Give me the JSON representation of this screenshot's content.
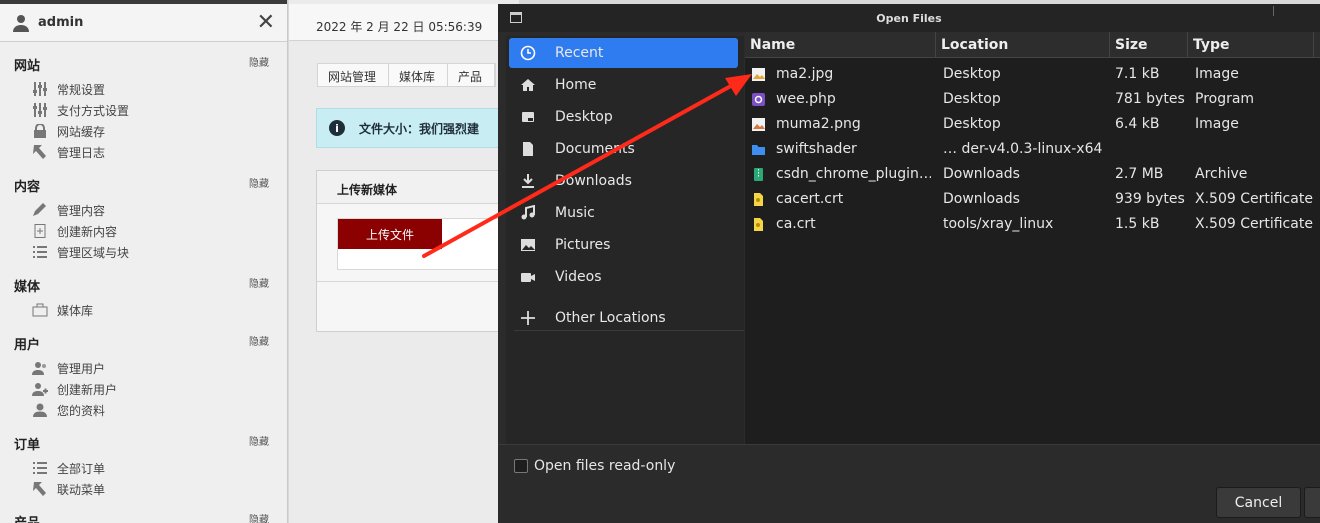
{
  "sidebar": {
    "username": "admin",
    "hide_label": "隐藏",
    "sections": [
      {
        "title": "网站",
        "items": [
          "常规设置",
          "支付方式设置",
          "网站缓存",
          "管理日志"
        ]
      },
      {
        "title": "内容",
        "items": [
          "管理内容",
          "创建新内容",
          "管理区域与块"
        ]
      },
      {
        "title": "媒体",
        "items": [
          "媒体库"
        ]
      },
      {
        "title": "用户",
        "items": [
          "管理用户",
          "创建新用户",
          "您的资料"
        ]
      },
      {
        "title": "订单",
        "items": [
          "全部订单",
          "联动菜单"
        ]
      },
      {
        "title": "产品",
        "items": []
      }
    ]
  },
  "main": {
    "datetime": "2022 年 2 月 22 日 05:56:39",
    "breadcrumbs": [
      "网站管理",
      "媒体库",
      "产品"
    ],
    "notice": "文件大小：我们强烈建",
    "panel_title": "上传新媒体",
    "upload_button": "上传文件"
  },
  "dialog": {
    "title": "Open Files",
    "places": [
      {
        "label": "Recent",
        "icon": "clock-icon",
        "active": true
      },
      {
        "label": "Home",
        "icon": "home-icon"
      },
      {
        "label": "Desktop",
        "icon": "desktop-icon"
      },
      {
        "label": "Documents",
        "icon": "document-icon"
      },
      {
        "label": "Downloads",
        "icon": "download-icon"
      },
      {
        "label": "Music",
        "icon": "music-icon"
      },
      {
        "label": "Pictures",
        "icon": "pictures-icon"
      },
      {
        "label": "Videos",
        "icon": "videos-icon"
      },
      {
        "label": "Other Locations",
        "icon": "plus-icon"
      }
    ],
    "columns": [
      "Name",
      "Location",
      "Size",
      "Type"
    ],
    "files": [
      {
        "name": "ma2.jpg",
        "location": "Desktop",
        "size": "7.1 kB",
        "type": "Image",
        "icon": "image-file-icon"
      },
      {
        "name": "wee.php",
        "location": "Desktop",
        "size": "781 bytes",
        "type": "Program",
        "icon": "php-file-icon"
      },
      {
        "name": "muma2.png",
        "location": "Desktop",
        "size": "6.4 kB",
        "type": "Image",
        "icon": "image-file-icon"
      },
      {
        "name": "swiftshader",
        "location": "… der-v4.0.3-linux-x64",
        "size": "",
        "type": "",
        "icon": "folder-icon"
      },
      {
        "name": "csdn_chrome_plugin…",
        "location": "Downloads",
        "size": "2.7 MB",
        "type": "Archive",
        "icon": "archive-file-icon"
      },
      {
        "name": "cacert.crt",
        "location": "Downloads",
        "size": "939 bytes",
        "type": "X.509 Certificate",
        "icon": "certificate-file-icon"
      },
      {
        "name": "ca.crt",
        "location": "tools/xray_linux",
        "size": "1.5 kB",
        "type": "X.509 Certificate",
        "icon": "certificate-file-icon"
      }
    ],
    "readonly_label": "Open files read-only",
    "cancel_label": "Cancel"
  },
  "colors": {
    "accent": "#2f7bf0",
    "upload": "#8b0000",
    "annotation_arrow": "#ff2a1a"
  }
}
